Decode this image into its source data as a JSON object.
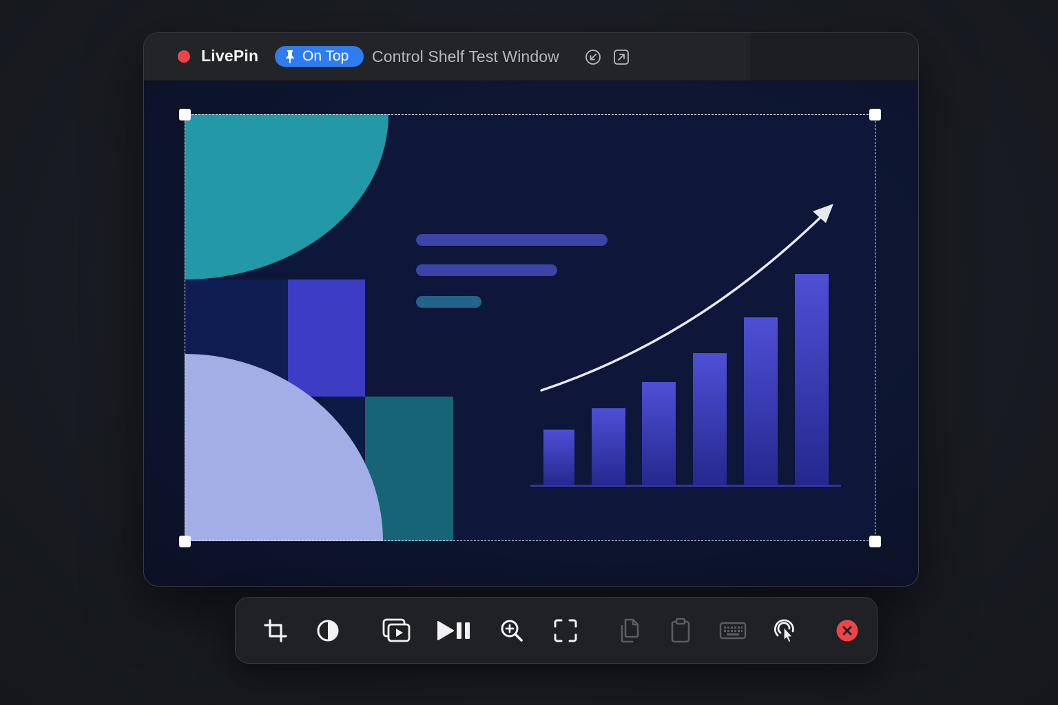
{
  "window": {
    "app_name": "LivePin",
    "badge_label": "On Top",
    "title": "Control Shelf Test Window",
    "title_icons": [
      "shrink-arrow-icon",
      "open-external-icon"
    ]
  },
  "preview": {
    "chart_bars_count": 6,
    "text_lines": 3
  },
  "shelf": {
    "buttons": [
      {
        "icon": "crop-icon",
        "enabled": true
      },
      {
        "icon": "contrast-icon",
        "enabled": true
      },
      {
        "icon": "media-play-icon",
        "enabled": true
      },
      {
        "icon": "play-pause-icon",
        "enabled": true
      },
      {
        "icon": "zoom-in-icon",
        "enabled": true
      },
      {
        "icon": "fullscreen-icon",
        "enabled": true
      },
      {
        "icon": "copy-icon",
        "enabled": false
      },
      {
        "icon": "clipboard-icon",
        "enabled": false
      },
      {
        "icon": "keyboard-icon",
        "enabled": false
      },
      {
        "icon": "click-through-icon",
        "enabled": true
      },
      {
        "icon": "close-icon",
        "enabled": true
      }
    ]
  },
  "colors": {
    "close_red": "#ef4447",
    "badge_blue": "#2f7cf0",
    "teal": "#2398a6",
    "indigo": "#3f3fc8",
    "lavender": "#a3aee6"
  }
}
